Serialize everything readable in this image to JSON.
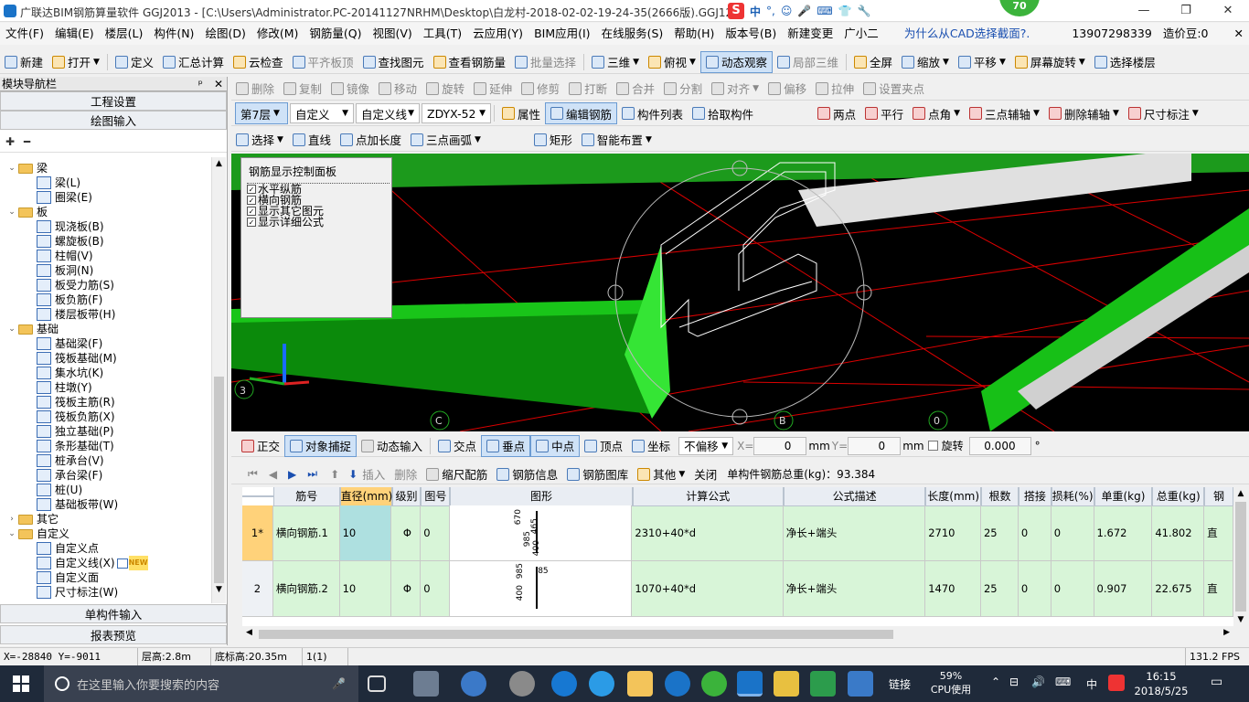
{
  "title": "广联达BIM钢筋算量软件 GGJ2013 - [C:\\Users\\Administrator.PC-20141127NRHM\\Desktop\\白龙村-2018-02-02-19-24-35(2666版).GGJ12]",
  "badge": "70",
  "ime": {
    "label": "中"
  },
  "window": {
    "minimize": "—",
    "restore": "❐",
    "close": "✕"
  },
  "menu": [
    "文件(F)",
    "编辑(E)",
    "楼层(L)",
    "构件(N)",
    "绘图(D)",
    "修改(M)",
    "钢筋量(Q)",
    "视图(V)",
    "工具(T)",
    "云应用(Y)",
    "BIM应用(I)",
    "在线服务(S)",
    "帮助(H)",
    "版本号(B)",
    "新建变更",
    "广小二"
  ],
  "menu_right": {
    "question": "为什么从CAD选择截面?.",
    "phone": "13907298339",
    "price": "造价豆:0"
  },
  "toolbar1": [
    "新建",
    "打开",
    "定义",
    "汇总计算",
    "云检查",
    "平齐板顶",
    "查找图元",
    "查看钢筋量",
    "批量选择",
    "三维",
    "俯视",
    "动态观察",
    "局部三维",
    "全屏",
    "缩放",
    "平移",
    "屏幕旋转",
    "选择楼层"
  ],
  "toolbar2": [
    "删除",
    "复制",
    "镜像",
    "移动",
    "旋转",
    "延伸",
    "修剪",
    "打断",
    "合并",
    "分割",
    "对齐",
    "偏移",
    "拉伸",
    "设置夹点"
  ],
  "toolbar3": {
    "floor": "第7层",
    "type": "自定义",
    "line": "自定义线",
    "code": "ZDYX-52",
    "props": "属性",
    "edit": "编辑钢筋",
    "list": "构件列表",
    "pick": "拾取构件",
    "snap": [
      "两点",
      "平行",
      "点角",
      "三点辅轴",
      "删除辅轴",
      "尺寸标注"
    ]
  },
  "toolbar4": [
    "选择",
    "直线",
    "点加长度",
    "三点画弧",
    "矩形",
    "智能布置"
  ],
  "nav": {
    "header": "模块导航栏",
    "pin": "ᵖ",
    "close": "✕",
    "project": "工程设置",
    "draw": "绘图输入",
    "single": "单构件输入",
    "report": "报表预览"
  },
  "tree": [
    {
      "level": 0,
      "label": "梁",
      "open": true
    },
    {
      "level": 1,
      "label": "梁(L)"
    },
    {
      "level": 1,
      "label": "圈梁(E)"
    },
    {
      "level": 0,
      "label": "板",
      "open": true
    },
    {
      "level": 1,
      "label": "现浇板(B)"
    },
    {
      "level": 1,
      "label": "螺旋板(B)"
    },
    {
      "level": 1,
      "label": "柱帽(V)"
    },
    {
      "level": 1,
      "label": "板洞(N)"
    },
    {
      "level": 1,
      "label": "板受力筋(S)"
    },
    {
      "level": 1,
      "label": "板负筋(F)"
    },
    {
      "level": 1,
      "label": "楼层板带(H)"
    },
    {
      "level": 0,
      "label": "基础",
      "open": true
    },
    {
      "level": 1,
      "label": "基础梁(F)"
    },
    {
      "level": 1,
      "label": "筏板基础(M)"
    },
    {
      "level": 1,
      "label": "集水坑(K)"
    },
    {
      "level": 1,
      "label": "柱墩(Y)"
    },
    {
      "level": 1,
      "label": "筏板主筋(R)"
    },
    {
      "level": 1,
      "label": "筏板负筋(X)"
    },
    {
      "level": 1,
      "label": "独立基础(P)"
    },
    {
      "level": 1,
      "label": "条形基础(T)"
    },
    {
      "level": 1,
      "label": "桩承台(V)"
    },
    {
      "level": 1,
      "label": "承台梁(F)"
    },
    {
      "level": 1,
      "label": "桩(U)"
    },
    {
      "level": 1,
      "label": "基础板带(W)"
    },
    {
      "level": 0,
      "label": "其它",
      "open": false
    },
    {
      "level": 0,
      "label": "自定义",
      "open": true
    },
    {
      "level": 1,
      "label": "自定义点"
    },
    {
      "level": 1,
      "label": "自定义线(X)",
      "new": "NEW"
    },
    {
      "level": 1,
      "label": "自定义面"
    },
    {
      "level": 1,
      "label": "尺寸标注(W)"
    }
  ],
  "rebar_panel": {
    "title": "钢筋显示控制面板",
    "items": [
      "水平纵筋",
      "横向钢筋",
      "显示其它图元",
      "显示详细公式"
    ]
  },
  "axes": {
    "c": "C",
    "b": "B",
    "zero": "0",
    "three": "3"
  },
  "snapbar": {
    "ortho": "正交",
    "snap": "对象捕捉",
    "dyn": "动态输入",
    "intersect": "交点",
    "perp": "垂点",
    "mid": "中点",
    "vertex": "顶点",
    "coord": "坐标",
    "offset": "不偏移",
    "xlabel": "X=",
    "x": "0",
    "ylabel": "Y=",
    "y": "0",
    "unit": "mm",
    "rotate": "旋转",
    "angle": "0.000",
    "deg": "°"
  },
  "gridtool": {
    "insert": "插入",
    "delete": "删除",
    "scale": "缩尺配筋",
    "info": "钢筋信息",
    "lib": "钢筋图库",
    "other": "其他",
    "close": "关闭",
    "total": "单构件钢筋总重(kg)：93.384"
  },
  "columns": [
    "筋号",
    "直径(mm)",
    "级别",
    "图号",
    "图形",
    "计算公式",
    "公式描述",
    "长度(mm)",
    "根数",
    "搭接",
    "损耗(%)",
    "单重(kg)",
    "总重(kg)",
    "钢"
  ],
  "rows": [
    {
      "idx": "1*",
      "name": "横向钢筋.1",
      "dia": "10",
      "grade": "Φ",
      "fig": "0",
      "formula": "2310+40*d",
      "desc": "净长+端头",
      "len": "2710",
      "count": "25",
      "lap": "0",
      "loss": "0",
      "unit": "1.672",
      "total": "41.802",
      "extra": "直",
      "shape": [
        "670",
        "465",
        "985",
        "400"
      ]
    },
    {
      "idx": "2",
      "name": "横向钢筋.2",
      "dia": "10",
      "grade": "Φ",
      "fig": "0",
      "formula": "1070+40*d",
      "desc": "净长+端头",
      "len": "1470",
      "count": "25",
      "lap": "0",
      "loss": "0",
      "unit": "0.907",
      "total": "22.675",
      "extra": "直",
      "shape": [
        "985",
        "400",
        "85"
      ]
    }
  ],
  "status": {
    "coords": "X=-28840 Y=-9011",
    "floor_h": "层高:2.8m",
    "base_h": "底标高:20.35m",
    "sel": "1(1)",
    "fps": "131.2 FPS"
  },
  "taskbar": {
    "search": "在这里输入你要搜索的内容",
    "link": "链接",
    "cpu_pct": "59%",
    "cpu": "CPU使用",
    "lang": "中",
    "time": "16:15",
    "date": "2018/5/25"
  }
}
